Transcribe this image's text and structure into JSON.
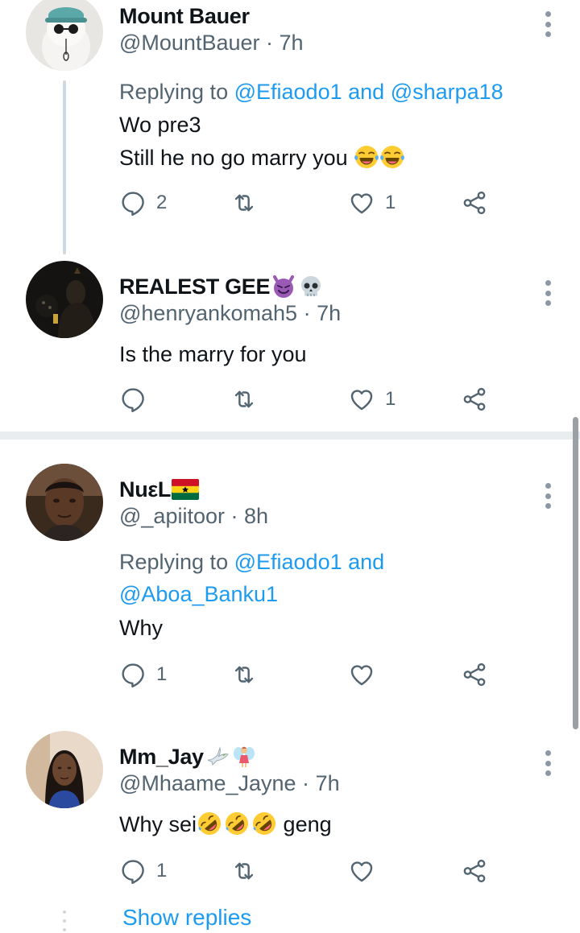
{
  "replies": [
    {
      "name": "Mount Bauer",
      "handle": "@MountBauer",
      "time": "7h",
      "replying_prefix": "Replying to",
      "replying_to": [
        "@Efiaodo1",
        "@sharpa18"
      ],
      "replying_joiner": "and",
      "text_lines": [
        "Wo pre3",
        "Still he no go marry you"
      ],
      "emoji": [
        "face-with-tears-of-joy",
        "face-with-tears-of-joy"
      ],
      "reply_count": "2",
      "retweet_count": "",
      "like_count": "1"
    },
    {
      "name": "REALEST GEE",
      "name_emoji": [
        "smiling-face-with-horns",
        "skull"
      ],
      "handle": "@henryankomah5",
      "time": "7h",
      "text_lines": [
        "Is the marry for you"
      ],
      "reply_count": "",
      "retweet_count": "",
      "like_count": "1"
    },
    {
      "name": "NuεL",
      "name_emoji": [
        "flag-ghana"
      ],
      "handle": "@_apiitoor",
      "time": "8h",
      "replying_prefix": "Replying to",
      "replying_to": [
        "@Efiaodo1",
        "@Aboa_Banku1"
      ],
      "replying_joiner": "and",
      "text_lines": [
        "Why"
      ],
      "reply_count": "1",
      "retweet_count": "",
      "like_count": ""
    },
    {
      "name": "Mm_Jay",
      "name_emoji": [
        "dove",
        "fairy"
      ],
      "handle": "@Mhaame_Jayne",
      "time": "7h",
      "text_parts": [
        "Why sei",
        "geng"
      ],
      "emoji": [
        "rolling-on-floor-laughing",
        "rolling-on-floor-laughing",
        "rolling-on-floor-laughing"
      ],
      "reply_count": "1",
      "retweet_count": "",
      "like_count": ""
    }
  ],
  "separator": "·",
  "show_replies_label": "Show replies",
  "colors": {
    "link": "#1d9bf0",
    "secondary_text": "#536471",
    "primary_text": "#0f1419",
    "thread_line": "#cfd9de",
    "divider": "#e9edf0"
  },
  "icons": [
    "reply-icon",
    "retweet-icon",
    "like-icon",
    "share-icon",
    "more-icon"
  ]
}
